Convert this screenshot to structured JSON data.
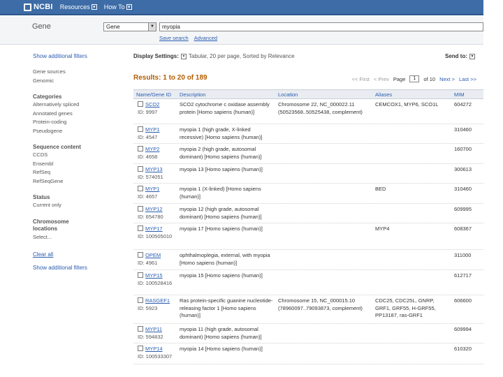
{
  "header": {
    "logo": "NCBI",
    "menus": [
      "Resources",
      "How To"
    ]
  },
  "search": {
    "database_title": "Gene",
    "database_select": "Gene",
    "query": "myopia",
    "links": [
      "Save search",
      "Advanced"
    ]
  },
  "sidebar": {
    "show_filters_top": "Show additional filters",
    "top_items": [
      "Gene sources",
      "Genomic"
    ],
    "categories": {
      "heading": "Categories",
      "items": [
        "Alternatively spliced",
        "Annotated genes",
        "Protein-coding",
        "Pseudogene"
      ]
    },
    "sequence_content": {
      "heading": "Sequence content",
      "items": [
        "CCDS",
        "Ensembl",
        "RefSeq",
        "RefSeqGene"
      ]
    },
    "status": {
      "heading": "Status",
      "items": [
        "Current only"
      ]
    },
    "chromosome": {
      "heading": "Chromosome locations",
      "items": [
        "Select..."
      ]
    },
    "clear_all": "Clear all",
    "show_filters_bottom": "Show additional filters"
  },
  "main": {
    "display_settings_label": "Display Settings:",
    "display_settings_value": "Tabular, 20 per page, Sorted by Relevance",
    "send_to": "Send to:",
    "results": "Results: 1 to 20 of 189",
    "pager": {
      "first": "<< First",
      "prev": "< Prev",
      "page_label": "Page",
      "page_value": "1",
      "of_pages": "of 10",
      "next": "Next >",
      "last": "Last >>"
    }
  },
  "table": {
    "headers": [
      "Name/Gene ID",
      "Description",
      "Location",
      "Aliases",
      "MIM"
    ],
    "rows": [
      {
        "symbol": "SCO2",
        "id": "ID: 9997",
        "desc": "SCO2 cytochrome c oxidase assembly protein [Homo sapiens (human)]",
        "loc": "Chromosome 22, NC_000022.11 (50523568..50525438, complement)",
        "alias": "CEMCOX1, MYP6, SCO1L",
        "mim": "604272"
      },
      {
        "symbol": "MYP1",
        "id": "ID: 4547",
        "desc": "myopia 1 (high grade, X-linked recessive) [Homo sapiens (human)]",
        "loc": "",
        "alias": "",
        "mim": "310460"
      },
      {
        "symbol": "MYP2",
        "id": "ID: 4658",
        "desc": "myopia 2 (high grade, autosomal dominant) [Homo sapiens (human)]",
        "loc": "",
        "alias": "",
        "mim": "160700"
      },
      {
        "symbol": "MYP13",
        "id": "ID: 574051",
        "desc": "myopia 13 [Homo sapiens (human)]",
        "loc": "",
        "alias": "",
        "mim": "300613"
      },
      {
        "symbol": "MYP1",
        "id": "ID: 4657",
        "desc": "myopia 1 (X-linked) [Homo sapiens (human)]",
        "loc": "",
        "alias": "BED",
        "mim": "310460"
      },
      {
        "symbol": "MYP12",
        "id": "ID: 654780",
        "desc": "myopia 12 (high grade, autosomal dominant) [Homo sapiens (human)]",
        "loc": "",
        "alias": "",
        "mim": "609995"
      },
      {
        "symbol": "MYP17",
        "id": "ID: 100505010",
        "desc": "myopia 17 [Homo sapiens (human)]",
        "loc": "",
        "alias": "MYP4",
        "mim": "608367"
      },
      {
        "symbol": "OPEM",
        "id": "ID: 4961",
        "desc": "ophthalmoplegia, external, with myopia [Homo sapiens (human)]",
        "loc": "",
        "alias": "",
        "mim": "311000"
      },
      {
        "symbol": "MYP15",
        "id": "ID: 100528416",
        "desc": "myopia 15 [Homo sapiens (human)]",
        "loc": "",
        "alias": "",
        "mim": "612717"
      },
      {
        "symbol": "RASGEF1",
        "id": "ID: 5923",
        "desc": "Ras protein-specific guanine nucleotide-releasing factor 1 [Homo sapiens (human)]",
        "loc": "Chromosome 15, NC_000015.10 (78960097..79093873, complement)",
        "alias": "CDC25, CDC25L, GNRP, GRF1, GRF55, H-GRF55, PP13187, ras-GRF1",
        "mim": "606600"
      },
      {
        "symbol": "MYP11",
        "id": "ID: 594832",
        "desc": "myopia 11 (high grade, autosomal dominant) [Homo sapiens (human)]",
        "loc": "",
        "alias": "",
        "mim": "609994"
      },
      {
        "symbol": "MYP14",
        "id": "ID: 100533307",
        "desc": "myopia 14 [Homo sapiens (human)]",
        "loc": "",
        "alias": "",
        "mim": "610320"
      }
    ]
  }
}
